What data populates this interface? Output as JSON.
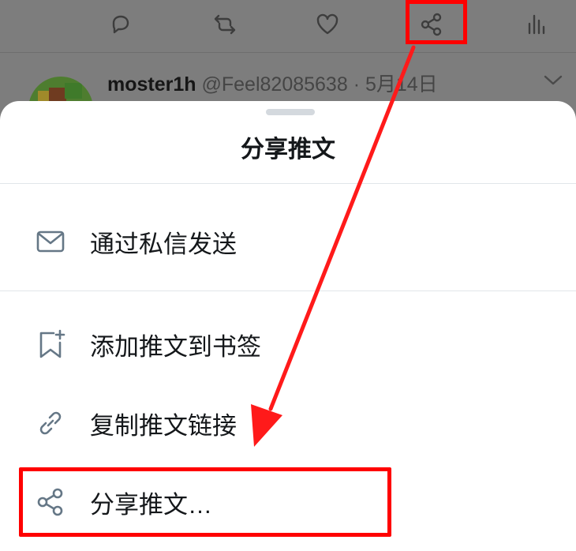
{
  "tweet": {
    "username": "moster1h",
    "handle_date": "@Feel82085638 · 5月14日"
  },
  "action_bar": {
    "icons": [
      "reply-icon",
      "retweet-icon",
      "like-icon",
      "share-icon",
      "analytics-icon"
    ]
  },
  "share_sheet": {
    "title": "分享推文",
    "items": [
      {
        "label": "通过私信发送",
        "icon": "mail-icon"
      },
      {
        "label": "添加推文到书签",
        "icon": "bookmark-add-icon"
      },
      {
        "label": "复制推文链接",
        "icon": "link-icon"
      },
      {
        "label": "分享推文…",
        "icon": "share-icon"
      }
    ]
  },
  "colors": {
    "annotation": "#ff0000",
    "sheet_background": "#ffffff",
    "overlay": "#7d7d7d",
    "icon_gray": "#657786"
  }
}
